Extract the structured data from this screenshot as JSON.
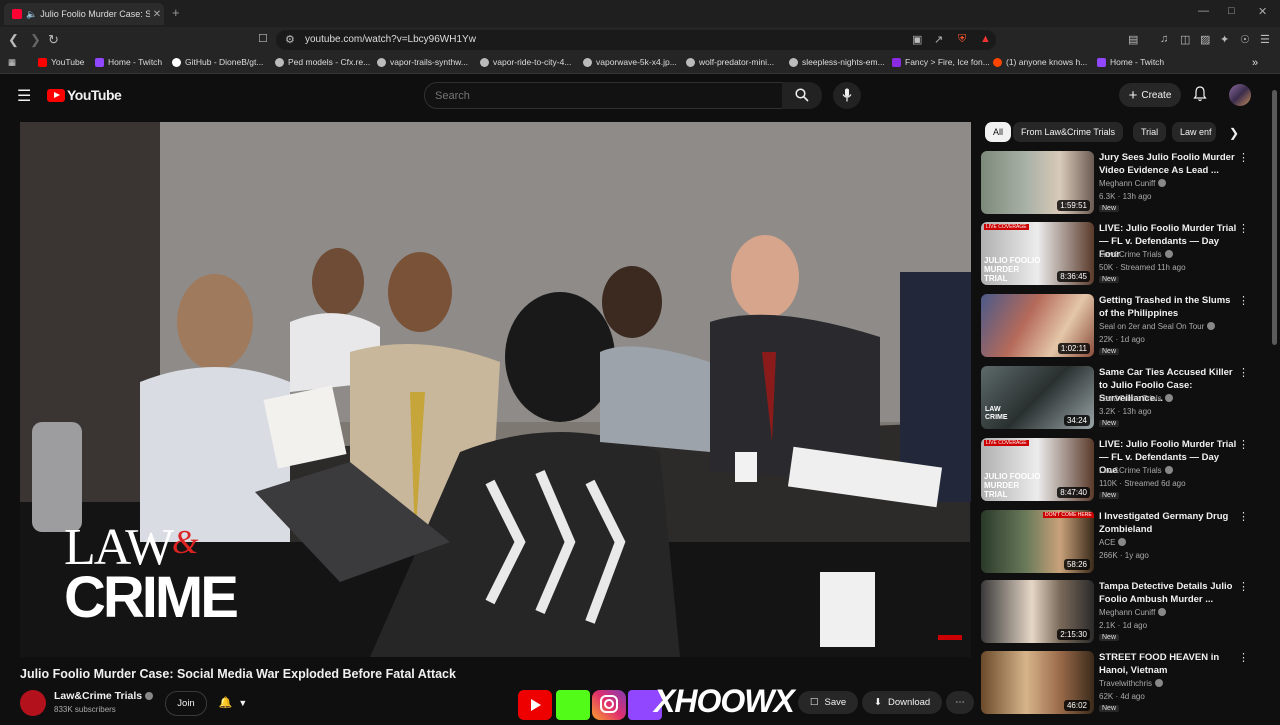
{
  "browser": {
    "tab_title": "Julio Foolio Murder Case: Sc",
    "new_tab": "+",
    "url": "youtube.com/watch?v=Lbcy96WH1Yw",
    "bookmarks": [
      {
        "label": "YouTube",
        "color": "#ff0000"
      },
      {
        "label": "Home - Twitch",
        "color": "#9146ff"
      },
      {
        "label": "GitHub - DioneB/gt...",
        "color": "#ffffff"
      },
      {
        "label": "Ped models - Cfx.re...",
        "color": "#bbbbbb"
      },
      {
        "label": "vapor-trails-synthw...",
        "color": "#bbbbbb"
      },
      {
        "label": "vapor-ride-to-city-4...",
        "color": "#bbbbbb"
      },
      {
        "label": "vaporwave-5k-x4.jp...",
        "color": "#bbbbbb"
      },
      {
        "label": "wolf-predator-mini...",
        "color": "#bbbbbb"
      },
      {
        "label": "sleepless-nights-em...",
        "color": "#bbbbbb"
      },
      {
        "label": "Fancy > Fire, Ice fon...",
        "color": "#8a2be2"
      },
      {
        "label": "(1) anyone knows h...",
        "color": "#ff4500"
      },
      {
        "label": "Home - Twitch",
        "color": "#9146ff"
      }
    ]
  },
  "header": {
    "logo_text": "YouTube",
    "search_placeholder": "Search",
    "create_label": "Create"
  },
  "video": {
    "watermark_line1": "LAW",
    "watermark_amp": "&",
    "watermark_line2": "CRIME",
    "title": "Julio Foolio Murder Case: Social Media War Exploded Before Fatal Attack",
    "channel": "Law&Crime Trials",
    "subscribers": "833K subscribers",
    "join_label": "Join",
    "save_label": "Save",
    "download_label": "Download",
    "overlay_text": "XHOOWX"
  },
  "chips": [
    "All",
    "From Law&Crime Trials",
    "Trial",
    "Law enf"
  ],
  "recommendations": [
    {
      "title": "Jury Sees Julio Foolio Murder Video Evidence As Lead ...",
      "channel": "Meghann Cuniff",
      "meta": "6.3K · 13h ago",
      "duration": "1:59:51",
      "badge": "New"
    },
    {
      "title": "LIVE: Julio Foolio Murder Trial — FL v. Defendants — Day Four",
      "channel": "Law&Crime Trials",
      "meta": "50K · Streamed 11h ago",
      "duration": "8:36:45",
      "badge": "New"
    },
    {
      "title": "Getting Trashed in the Slums of the Philippines",
      "channel": "Seal on 2er and Seal On Tour",
      "meta": "22K · 1d ago",
      "duration": "1:02:11",
      "badge": "New"
    },
    {
      "title": "Same Car Ties Accused Killer to Julio Foolio Case: Surveillance...",
      "channel": "Law&Crime Trials",
      "meta": "3.2K · 13h ago",
      "duration": "34:24",
      "badge": "New"
    },
    {
      "title": "LIVE: Julio Foolio Murder Trial — FL v. Defendants — Day One",
      "channel": "Law&Crime Trials",
      "meta": "110K · Streamed 6d ago",
      "duration": "8:47:40",
      "badge": "New"
    },
    {
      "title": "I Investigated Germany Drug Zombieland",
      "channel": "ACE",
      "meta": "266K · 1y ago",
      "duration": "58:26",
      "badge": ""
    },
    {
      "title": "Tampa Detective Details Julio Foolio Ambush Murder ...",
      "channel": "Meghann Cuniff",
      "meta": "2.1K · 1d ago",
      "duration": "2:15:30",
      "badge": "New"
    },
    {
      "title": "STREET FOOD HEAVEN in Hanoi, Vietnam",
      "channel": "Travelwithchris",
      "meta": "62K · 4d ago",
      "duration": "46:02",
      "badge": "New"
    }
  ],
  "thumb_overlays": {
    "live_coverage": "LIVE COVERAGE",
    "murder_trial": "JULIO FOOLIO MURDER TRIAL",
    "law_crime": "LAW CRIME",
    "dont_come": "DON'T COME HERE"
  },
  "colors": {
    "accent": "#ff0000",
    "bg": "#0f0f0f"
  }
}
